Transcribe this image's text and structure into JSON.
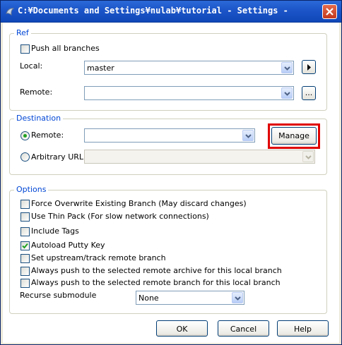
{
  "window": {
    "title": "C:¥Documents and Settings¥nulab¥tutorial - Settings -"
  },
  "ref": {
    "legend": "Ref",
    "push_all_branches": {
      "label": "Push all branches",
      "checked": false
    },
    "local": {
      "label": "Local:",
      "value": "master"
    },
    "remote": {
      "label": "Remote:",
      "value": ""
    },
    "browse_label": "..."
  },
  "destination": {
    "legend": "Destination",
    "remote": {
      "label": "Remote:",
      "value": "",
      "selected": true
    },
    "manage_label": "Manage",
    "arbitrary_url": {
      "label": "Arbitrary URL:",
      "value": "",
      "selected": false
    }
  },
  "options": {
    "legend": "Options",
    "items": [
      {
        "label": "Force Overwrite Existing Branch (May discard changes)",
        "checked": false
      },
      {
        "label": "Use Thin Pack (For slow network connections)",
        "checked": false
      },
      {
        "label": "Include Tags",
        "checked": false
      },
      {
        "label": "Autoload Putty Key",
        "checked": true
      },
      {
        "label": "Set upstream/track remote branch",
        "checked": false
      },
      {
        "label": "Always push to the selected remote archive for this local branch",
        "checked": false
      },
      {
        "label": "Always push to the selected remote branch for this local branch",
        "checked": false
      }
    ],
    "recurse_submodule": {
      "label": "Recurse submodule",
      "value": "None"
    }
  },
  "buttons": {
    "ok": "OK",
    "cancel": "Cancel",
    "help": "Help"
  },
  "colors": {
    "highlight": "#e00000",
    "legend": "#0046d5",
    "titlebar": "#1c55c8"
  }
}
